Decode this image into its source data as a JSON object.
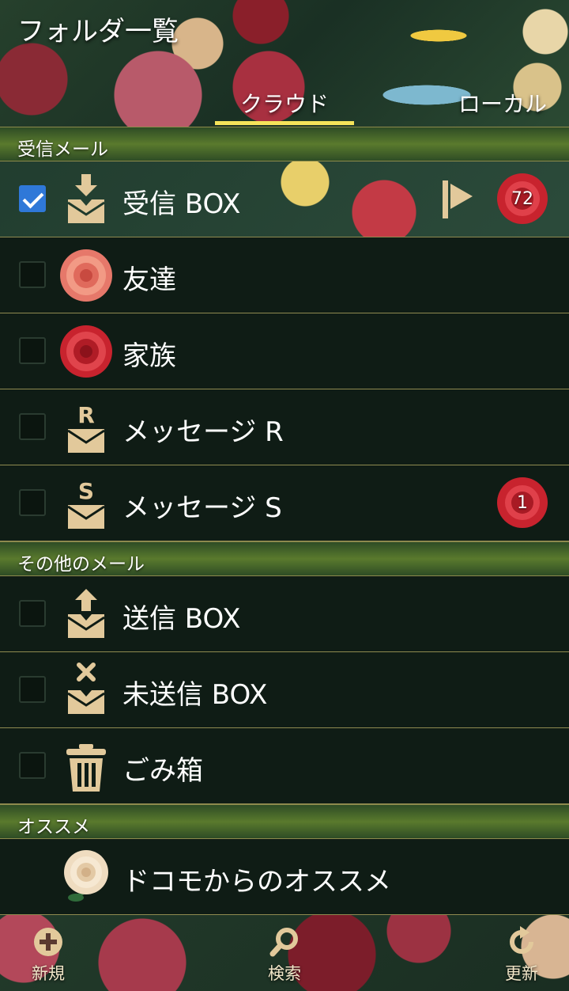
{
  "header": {
    "title": "フォルダ一覧",
    "tabs": [
      {
        "label": "クラウド",
        "active": true
      },
      {
        "label": "ローカル",
        "active": false
      }
    ]
  },
  "sections": {
    "inbox": "受信メール",
    "other": "その他のメール",
    "recommend": "オススメ"
  },
  "folders": [
    {
      "label": "受信 BOX",
      "checked": true,
      "icon": "inbox-download-icon",
      "badge": "72",
      "flag": true
    },
    {
      "label": "友達",
      "checked": false,
      "icon": "pink-rose-icon",
      "badge": "",
      "flag": false
    },
    {
      "label": "家族",
      "checked": false,
      "icon": "red-rose-icon",
      "badge": "",
      "flag": false
    },
    {
      "label": "メッセージ R",
      "checked": false,
      "icon": "message-r-icon",
      "badge": "",
      "flag": false
    },
    {
      "label": "メッセージ S",
      "checked": false,
      "icon": "message-s-icon",
      "badge": "1",
      "flag": false
    }
  ],
  "other_folders": [
    {
      "label": "送信 BOX",
      "checked": false,
      "icon": "outbox-upload-icon"
    },
    {
      "label": "未送信 BOX",
      "checked": false,
      "icon": "unsent-x-icon"
    },
    {
      "label": "ごみ箱",
      "checked": false,
      "icon": "trash-icon"
    }
  ],
  "recommend_items": [
    {
      "label": "ドコモからのオススメ",
      "icon": "white-rose-icon"
    }
  ],
  "bottom_bar": [
    {
      "label": "新規",
      "icon": "plus-circle-icon"
    },
    {
      "label": "検索",
      "icon": "search-icon"
    },
    {
      "label": "更新",
      "icon": "refresh-icon"
    }
  ],
  "colors": {
    "accent_underline": "#f5e35a",
    "icon_beige": "#e2c99b",
    "row_bg": "#0f1c15",
    "divider": "#8f8a50",
    "checkbox_checked": "#2f78d8",
    "badge_red": "#c8232e"
  }
}
